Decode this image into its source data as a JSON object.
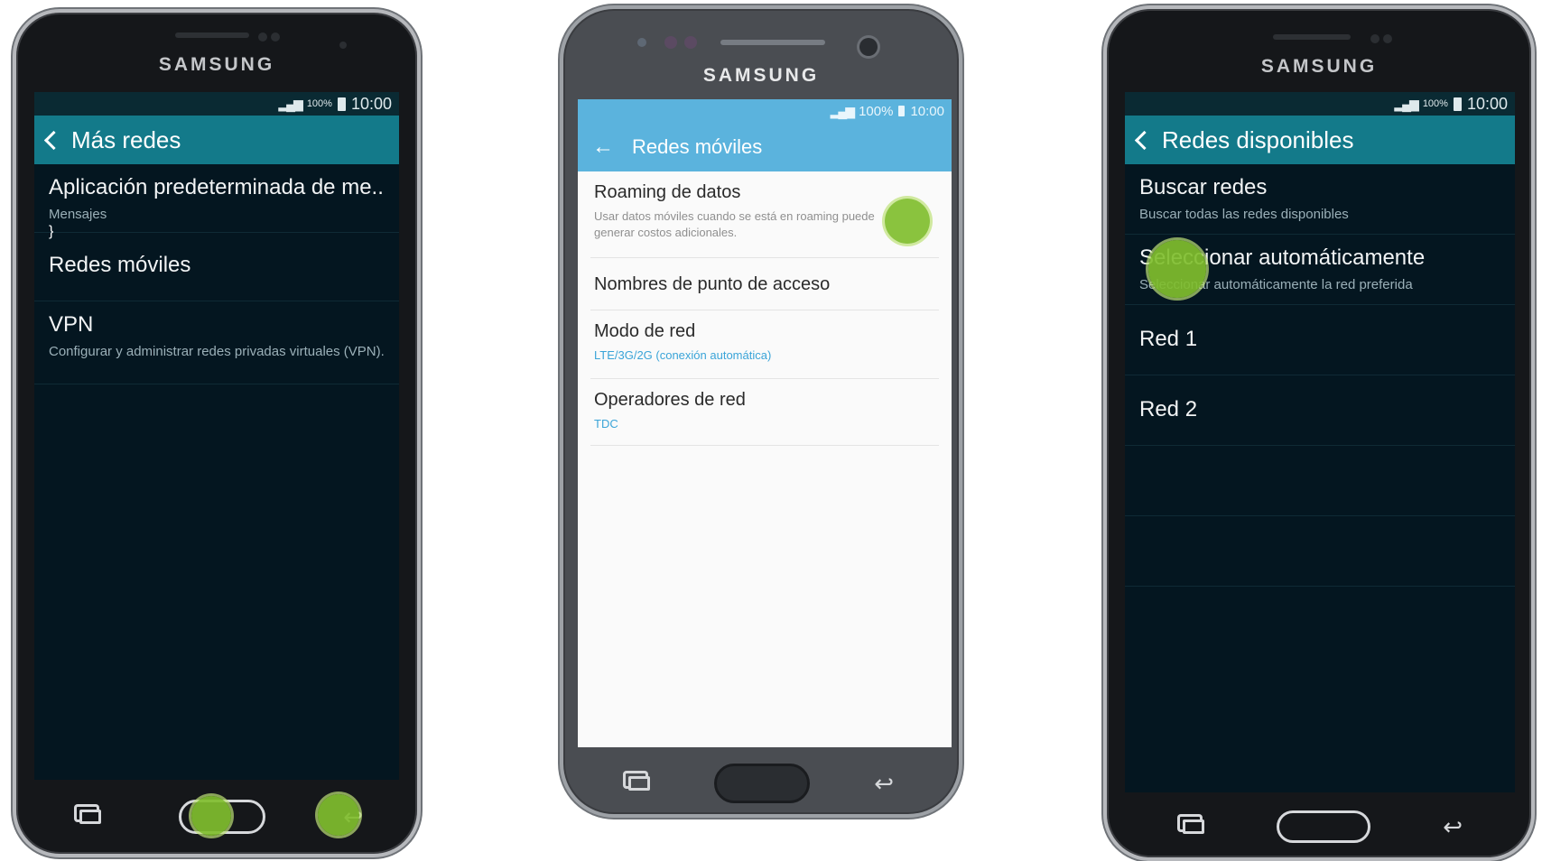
{
  "brand": "SAMSUNG",
  "phone1": {
    "status": {
      "battery_pct": "100%",
      "time": "10:00"
    },
    "title": "Más redes",
    "items": [
      {
        "title": "Aplicación predeterminada de me..",
        "subtitle": "Mensajes"
      },
      {
        "title": "Redes móviles",
        "subtitle": ""
      },
      {
        "title": "VPN",
        "subtitle": "Configurar y administrar redes privadas virtuales (VPN)."
      }
    ]
  },
  "phone2": {
    "status": {
      "battery_pct": "100%",
      "time": "10:00"
    },
    "title": "Redes móviles",
    "items": [
      {
        "title": "Roaming de datos",
        "subtitle": "Usar datos móviles cuando se está en roaming puede generar costos adicionales."
      },
      {
        "title": "Nombres de punto de acceso",
        "subtitle": ""
      },
      {
        "title": "Modo de red",
        "subtitle": "LTE/3G/2G (conexión automática)"
      },
      {
        "title": "Operadores de red",
        "subtitle": "TDC"
      }
    ]
  },
  "phone3": {
    "status": {
      "battery_pct": "100%",
      "time": "10:00"
    },
    "title": "Redes disponibles",
    "items": [
      {
        "title": "Buscar redes",
        "subtitle": "Buscar todas las redes disponibles"
      },
      {
        "title": "Seleccionar automáticamente",
        "subtitle": "Seleccionar automáticamente la red preferida"
      },
      {
        "title": "Red 1",
        "subtitle": ""
      },
      {
        "title": "Red 2",
        "subtitle": ""
      }
    ]
  },
  "colors": {
    "dark_appbar": "#137a8a",
    "light_appbar": "#5bb3dd",
    "touch_indicator": "#80be2e",
    "accent_text": "#3aa4d8"
  },
  "icons": [
    "back-chevron-icon",
    "back-arrow-icon",
    "signal-icon",
    "battery-icon",
    "recent-apps-icon",
    "home-button",
    "back-nav-icon"
  ]
}
